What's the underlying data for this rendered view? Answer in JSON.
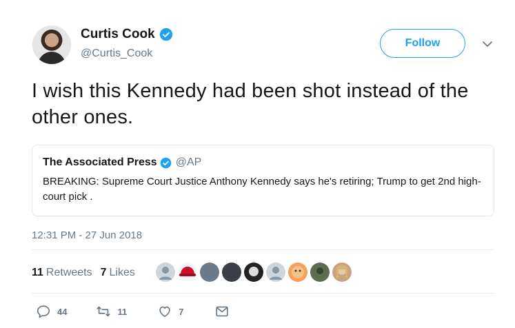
{
  "author": {
    "display_name": "Curtis Cook",
    "handle": "@Curtis_Cook",
    "verified_icon": "verified-badge-icon"
  },
  "follow_button_label": "Follow",
  "tweet_text": "I wish this Kennedy had been shot instead of the other ones.",
  "quoted_tweet": {
    "display_name": "The Associated Press",
    "handle": "@AP",
    "text": "BREAKING: Supreme Court Justice Anthony Kennedy says he's retiring; Trump to get 2nd high-court pick ."
  },
  "timestamp": "12:31 PM - 27 Jun 2018",
  "stats": {
    "retweets_count": "11",
    "retweets_label": "Retweets",
    "likes_count": "7",
    "likes_label": "Likes"
  },
  "actions": {
    "reply_count": "44",
    "retweet_count": "11",
    "like_count": "7"
  },
  "colors": {
    "accent": "#1da1f2",
    "muted": "#657786",
    "border": "#e1e8ed"
  }
}
